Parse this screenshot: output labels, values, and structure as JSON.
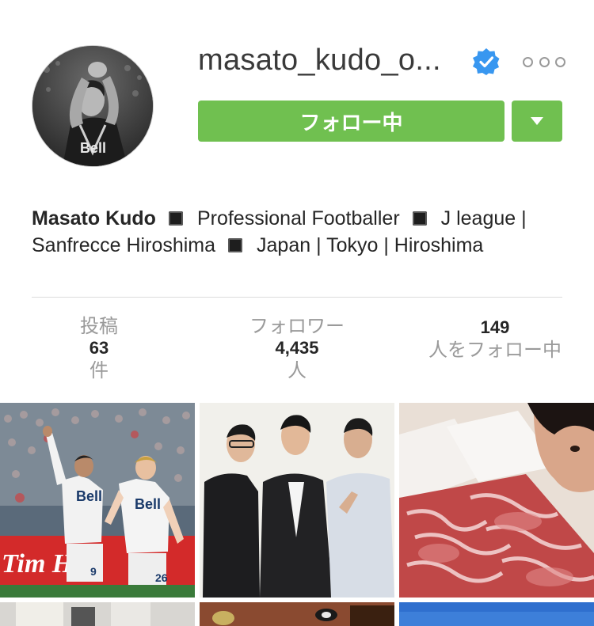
{
  "profile": {
    "username": "masato_kudo_o...",
    "verified": true,
    "follow_label": "フォロー中",
    "more_icon": "ellipsis-icon",
    "dropdown_icon": "chevron-down-icon",
    "accent_color": "#70c050",
    "verified_color": "#3897f0"
  },
  "bio": {
    "name": "Masato Kudo",
    "line_parts": [
      "Professional Footballer",
      "J league |",
      "Sanfrecce Hiroshima",
      "Japan | Tokyo | Hiroshima"
    ]
  },
  "stats": {
    "posts_label": "投稿",
    "posts_count": "63",
    "posts_unit": "件",
    "followers_label": "フォロワー",
    "followers_count": "4,435",
    "followers_unit": "人",
    "following_count": "149",
    "following_label": "人をフォロー中"
  },
  "grid": {
    "tiles": [
      {
        "description": "soccer-celebration-photo"
      },
      {
        "description": "three-men-posing-photo"
      },
      {
        "description": "sliced-meat-selfie-photo"
      },
      {
        "description": "room-interior-photo"
      },
      {
        "description": "restaurant-table-photo"
      },
      {
        "description": "blue-sky-photo"
      }
    ]
  }
}
